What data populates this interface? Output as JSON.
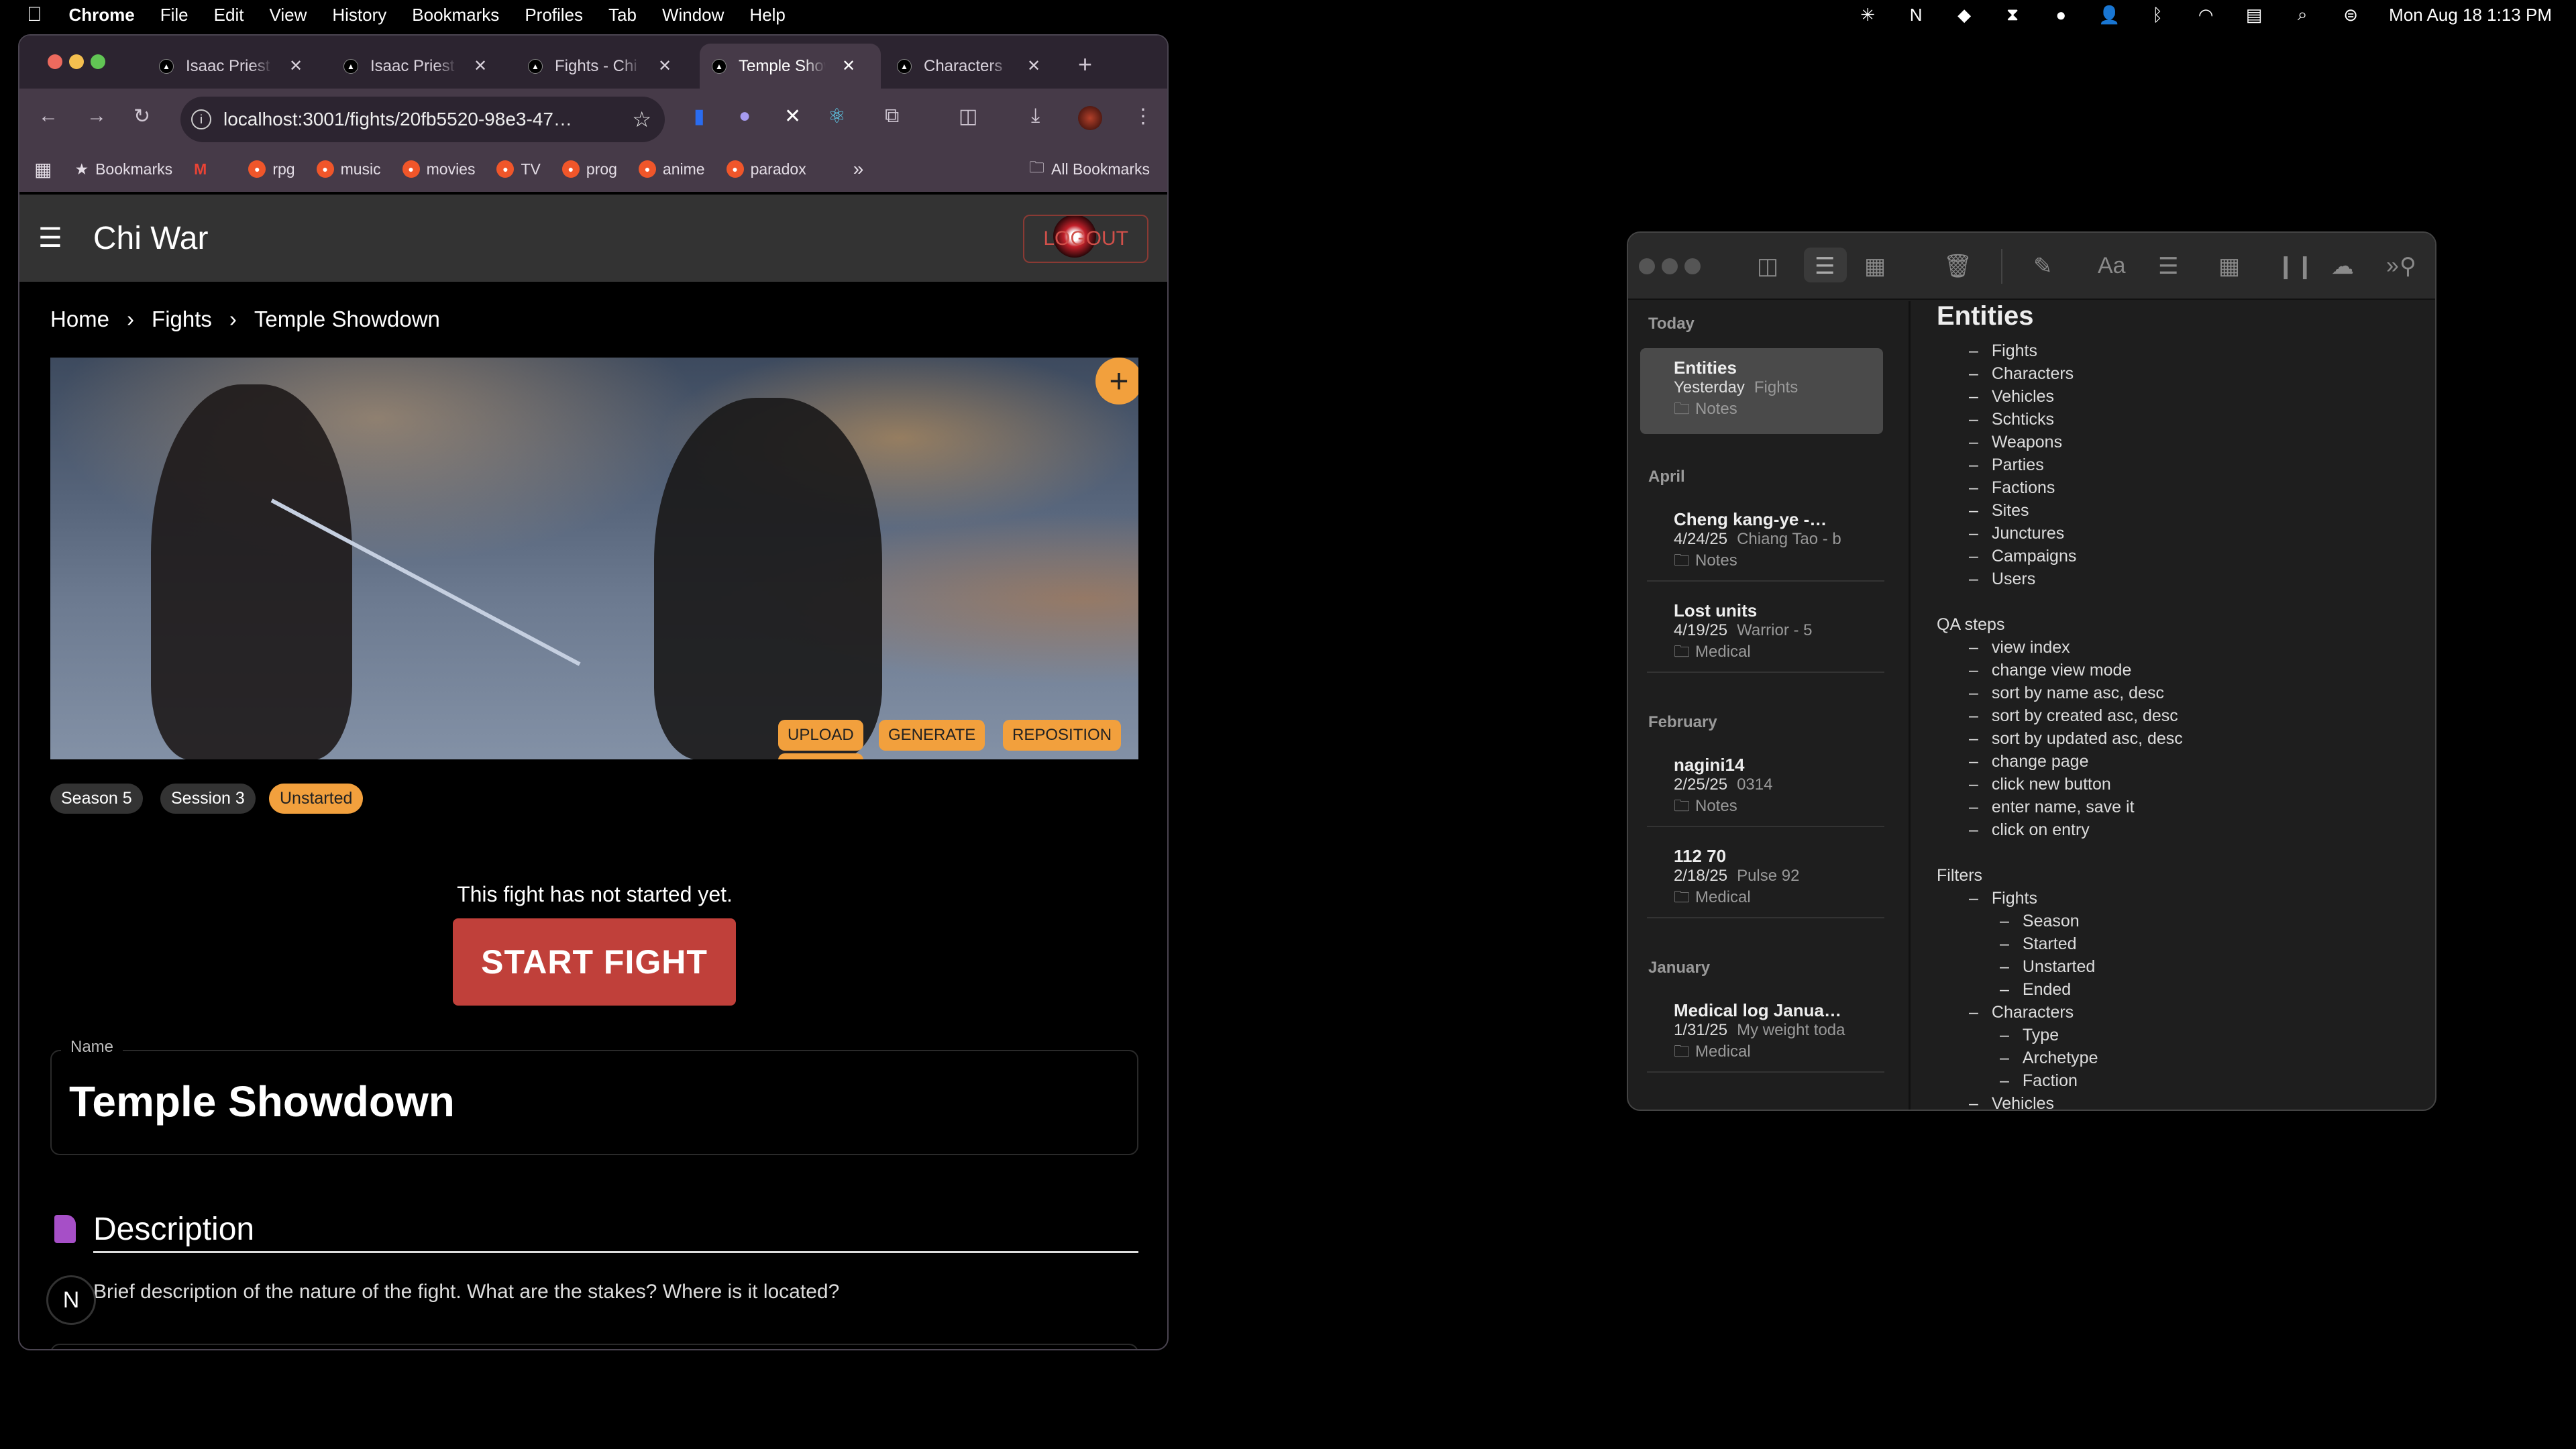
{
  "menubar": {
    "app": "Chrome",
    "items": [
      "File",
      "Edit",
      "View",
      "History",
      "Bookmarks",
      "Profiles",
      "Tab",
      "Window",
      "Help"
    ],
    "clock": "Mon Aug 18  1:13 PM",
    "status_icons": [
      "perplexity-icon",
      "notion-icon",
      "dropbox-icon",
      "bartender-icon",
      "profile-badge-icon",
      "user-icon",
      "bluetooth-icon",
      "wifi-icon",
      "keyboard-icon",
      "spotlight-icon",
      "control-center-icon"
    ]
  },
  "browser": {
    "tabs": [
      {
        "title": "Isaac Priest",
        "active": false
      },
      {
        "title": "Isaac Priest",
        "active": false
      },
      {
        "title": "Fights - Chi War",
        "active": false
      },
      {
        "title": "Temple Showdown",
        "active": true
      },
      {
        "title": "Characters",
        "active": false
      }
    ],
    "url": "localhost:3001/fights/20fb5520-98e3-47…",
    "bookmarks": [
      {
        "label": "Bookmarks"
      },
      {
        "label": "rpg"
      },
      {
        "label": "music"
      },
      {
        "label": "movies"
      },
      {
        "label": "TV"
      },
      {
        "label": "prog"
      },
      {
        "label": "anime"
      },
      {
        "label": "paradox"
      }
    ],
    "all_bookmarks": "All Bookmarks"
  },
  "app": {
    "title": "Chi War",
    "logout": "LOGOUT",
    "breadcrumb": [
      "Home",
      "Fights",
      "Temple Showdown"
    ],
    "image_buttons": {
      "upload": "UPLOAD",
      "generate": "GENERATE",
      "reposition": "REPOSITION",
      "add": "+"
    },
    "chips": [
      "Season 5",
      "Session 3",
      "Unstarted"
    ],
    "not_started": "This fight has not started yet.",
    "start_fight": "START FIGHT",
    "name_label": "Name",
    "name_value": "Temple Showdown",
    "description_heading": "Description",
    "description_placeholder": "Brief description of the nature of the fight. What are the stakes? Where is it located?",
    "nextjs_badge": "N",
    "colors": {
      "accent": "#f2a03d",
      "start": "#c0403a",
      "logout": "#c0504a",
      "header": "#333333"
    }
  },
  "notes": {
    "sections": [
      {
        "label": "Today",
        "items": [
          {
            "title": "Entities",
            "date": "Yesterday",
            "preview": "Fights",
            "folder": "Notes",
            "selected": true
          }
        ]
      },
      {
        "label": "April",
        "items": [
          {
            "title": "Cheng kang-ye -…",
            "date": "4/24/25",
            "preview": "Chiang Tao - b",
            "folder": "Notes"
          },
          {
            "title": "Lost units",
            "date": "4/19/25",
            "preview": "Warrior - 5",
            "folder": "Medical"
          }
        ]
      },
      {
        "label": "February",
        "items": [
          {
            "title": "nagini14",
            "date": "2/25/25",
            "preview": "0314",
            "folder": "Notes"
          },
          {
            "title": "112 70",
            "date": "2/18/25",
            "preview": "Pulse 92",
            "folder": "Medical"
          }
        ]
      },
      {
        "label": "January",
        "items": [
          {
            "title": "Medical log Janua…",
            "date": "1/31/25",
            "preview": "My weight toda",
            "folder": "Medical"
          }
        ]
      }
    ],
    "heading": "Entities",
    "lines": [
      {
        "t": "Fights",
        "l": 1
      },
      {
        "t": "Characters",
        "l": 1
      },
      {
        "t": "Vehicles",
        "l": 1
      },
      {
        "t": "Schticks",
        "l": 1
      },
      {
        "t": "Weapons",
        "l": 1
      },
      {
        "t": "Parties",
        "l": 1
      },
      {
        "t": "Factions",
        "l": 1
      },
      {
        "t": "Sites",
        "l": 1
      },
      {
        "t": "Junctures",
        "l": 1
      },
      {
        "t": "Campaigns",
        "l": 1
      },
      {
        "t": "Users",
        "l": 1
      },
      {
        "t": "",
        "l": 0
      },
      {
        "t": "QA steps",
        "l": 0
      },
      {
        "t": "view index",
        "l": 1
      },
      {
        "t": "change view mode",
        "l": 1
      },
      {
        "t": "sort by name asc, desc",
        "l": 1
      },
      {
        "t": "sort by created asc, desc",
        "l": 1
      },
      {
        "t": "sort by updated asc, desc",
        "l": 1
      },
      {
        "t": "change page",
        "l": 1
      },
      {
        "t": "click new button",
        "l": 1
      },
      {
        "t": "enter name, save it",
        "l": 1
      },
      {
        "t": "click on entry",
        "l": 1
      },
      {
        "t": "",
        "l": 0
      },
      {
        "t": "Filters",
        "l": 0
      },
      {
        "t": "Fights",
        "l": 1
      },
      {
        "t": "Season",
        "l": 2
      },
      {
        "t": "Started",
        "l": 2
      },
      {
        "t": "Unstarted",
        "l": 2
      },
      {
        "t": "Ended",
        "l": 2
      },
      {
        "t": "Characters",
        "l": 1
      },
      {
        "t": "Type",
        "l": 2
      },
      {
        "t": "Archetype",
        "l": 2
      },
      {
        "t": "Faction",
        "l": 2
      },
      {
        "t": "Vehicles",
        "l": 1
      }
    ]
  }
}
